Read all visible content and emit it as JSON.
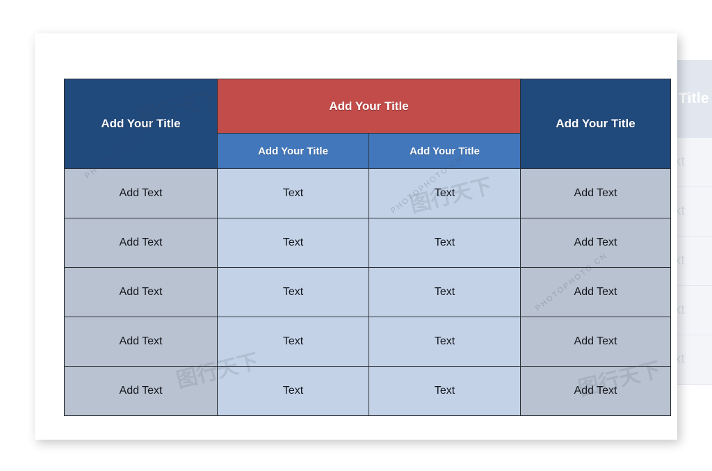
{
  "document": {
    "type": "table-template-slide",
    "colors": {
      "header_navy": "#20497c",
      "header_red": "#c24c4a",
      "header_blue": "#4277bb",
      "body_outer": "#b9c2d0",
      "body_inner": "#c3d2e7",
      "grid_line": "#2b2f36",
      "card_background": "#ffffff"
    }
  },
  "table": {
    "header": {
      "col1_title": "Add Your Title",
      "group_title": "Add Your Title",
      "sub_col2_title": "Add Your Title",
      "sub_col3_title": "Add Your Title",
      "col4_title": "Add Your Title"
    },
    "rows": [
      {
        "col1": "Add Text",
        "col2": "Text",
        "col3": "Text",
        "col4": "Add Text"
      },
      {
        "col1": "Add Text",
        "col2": "Text",
        "col3": "Text",
        "col4": "Add Text"
      },
      {
        "col1": "Add Text",
        "col2": "Text",
        "col3": "Text",
        "col4": "Add Text"
      },
      {
        "col1": "Add Text",
        "col2": "Text",
        "col3": "Text",
        "col4": "Add Text"
      },
      {
        "col1": "Add Text",
        "col2": "Text",
        "col3": "Text",
        "col4": "Add Text"
      }
    ]
  },
  "background_card": {
    "header_title": "Title",
    "rows": [
      "xt",
      "xt",
      "xt",
      "xt",
      "xt"
    ]
  },
  "watermarks": {
    "site": "PHOTOPHOTO.CN",
    "mark": "图行天下"
  }
}
